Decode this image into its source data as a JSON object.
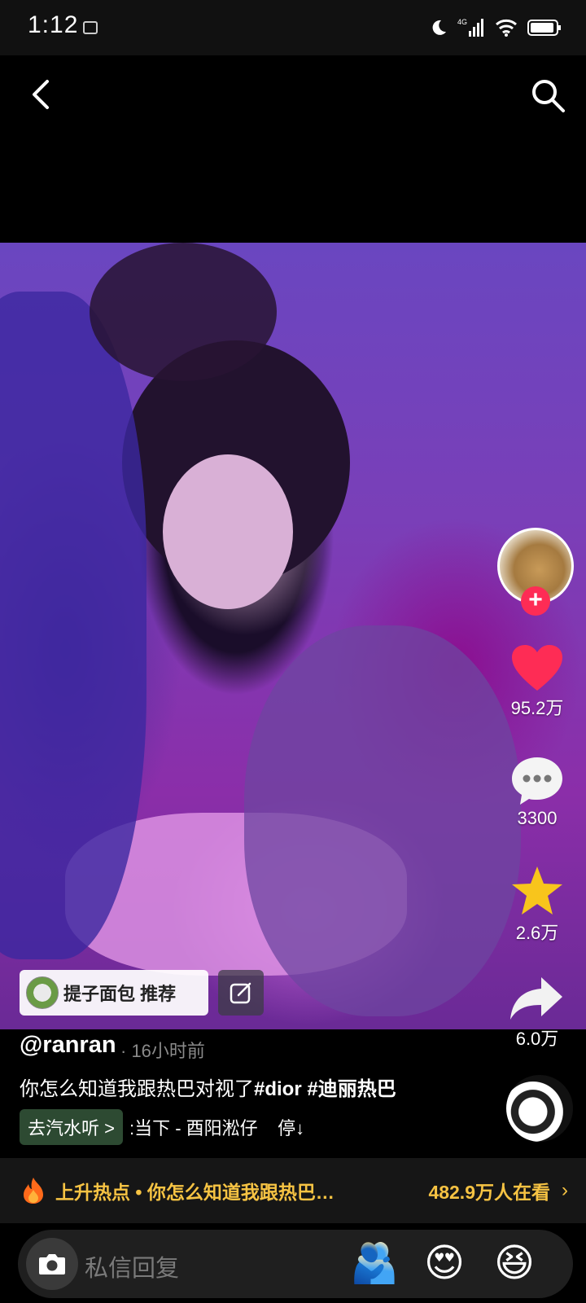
{
  "status_bar": {
    "time": "1:12"
  },
  "video": {
    "author_avatar": "dog-avatar",
    "actions": {
      "likes": "95.2万",
      "comments": "3300",
      "favorites": "2.6万",
      "shares": "6.0万"
    },
    "recommend_chip": {
      "label": "提子面包 推荐"
    },
    "username": "@ranran",
    "post_time": "· 16小时前",
    "caption_text": "你怎么知道我跟热巴对视了",
    "hashtags": [
      "#dior",
      "#迪丽热巴"
    ],
    "music": {
      "cta": "去汽水听 >",
      "title": ":当下 - 酉阳淞仔    停↓"
    }
  },
  "hot_bar": {
    "label": "上升热点 • 你怎么知道我跟热巴…",
    "viewers": "482.9万人在看",
    "arrow": "›"
  },
  "reply_bar": {
    "placeholder": "私信回复",
    "emojis": [
      "🫂",
      "😍",
      "😆"
    ]
  },
  "colors": {
    "like": "#fe2c55",
    "favorite": "#f8c51c",
    "hot": "#f6c343"
  }
}
